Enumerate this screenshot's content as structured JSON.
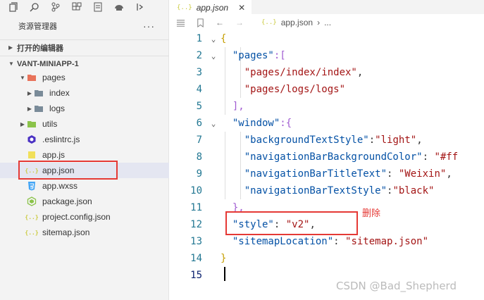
{
  "sidebar": {
    "activity_icons": [
      "files-icon",
      "search-icon",
      "source-control-icon",
      "extensions-icon",
      "docs-icon",
      "remote-icon",
      "more-icon"
    ],
    "explorer_title": "资源管理器",
    "explorer_more": "···",
    "open_editors": "打开的编辑器",
    "project_name": "VANT-MINIAPP-1",
    "tree": [
      {
        "label": "pages",
        "icon": "folder-open-icon"
      },
      {
        "label": "index",
        "icon": "folder-icon"
      },
      {
        "label": "logs",
        "icon": "folder-icon"
      },
      {
        "label": "utils",
        "icon": "folder-icon"
      },
      {
        "label": ".eslintrc.js",
        "icon": "eslint-icon"
      },
      {
        "label": "app.js",
        "icon": "js-icon"
      },
      {
        "label": "app.json",
        "icon": "json-icon"
      },
      {
        "label": "app.wxss",
        "icon": "css-icon"
      },
      {
        "label": "package.json",
        "icon": "npm-icon"
      },
      {
        "label": "project.config.json",
        "icon": "json-icon"
      },
      {
        "label": "sitemap.json",
        "icon": "json-icon"
      }
    ]
  },
  "editor": {
    "tab_label": "app.json",
    "tab_icon": "{..}",
    "breadcrumb_file": "app.json",
    "breadcrumb_more": "...",
    "line_numbers": [
      "1",
      "2",
      "3",
      "4",
      "5",
      "6",
      "7",
      "8",
      "9",
      "10",
      "11",
      "12",
      "13",
      "14",
      "15"
    ],
    "code": {
      "l1": "{",
      "l2_key": "\"pages\"",
      "l2_rest": ":[",
      "l3": "\"pages/index/index\"",
      "l4": "\"pages/logs/logs\"",
      "l5": "],",
      "l6_key": "\"window\"",
      "l6_rest": ":{",
      "l7_key": "\"backgroundTextStyle\"",
      "l7_val": "\"light\"",
      "l8_key": "\"navigationBarBackgroundColor\"",
      "l8_val": "\"#ff",
      "l9_key": "\"navigationBarTitleText\"",
      "l9_val": "\"Weixin\"",
      "l10_key": "\"navigationBarTextStyle\"",
      "l10_val": "\"black\"",
      "l11": "},",
      "l12_key": "\"style\"",
      "l12_val": "\"v2\"",
      "l13_key": "\"sitemapLocation\"",
      "l13_val": "\"sitemap.json\"",
      "l14": "}"
    }
  },
  "annotation": "删除",
  "watermark": "CSDN @Bad_Shepherd",
  "colors": {
    "highlight": "#e53935",
    "key": "#0451a5",
    "string": "#a31515",
    "line_number": "#237893"
  }
}
